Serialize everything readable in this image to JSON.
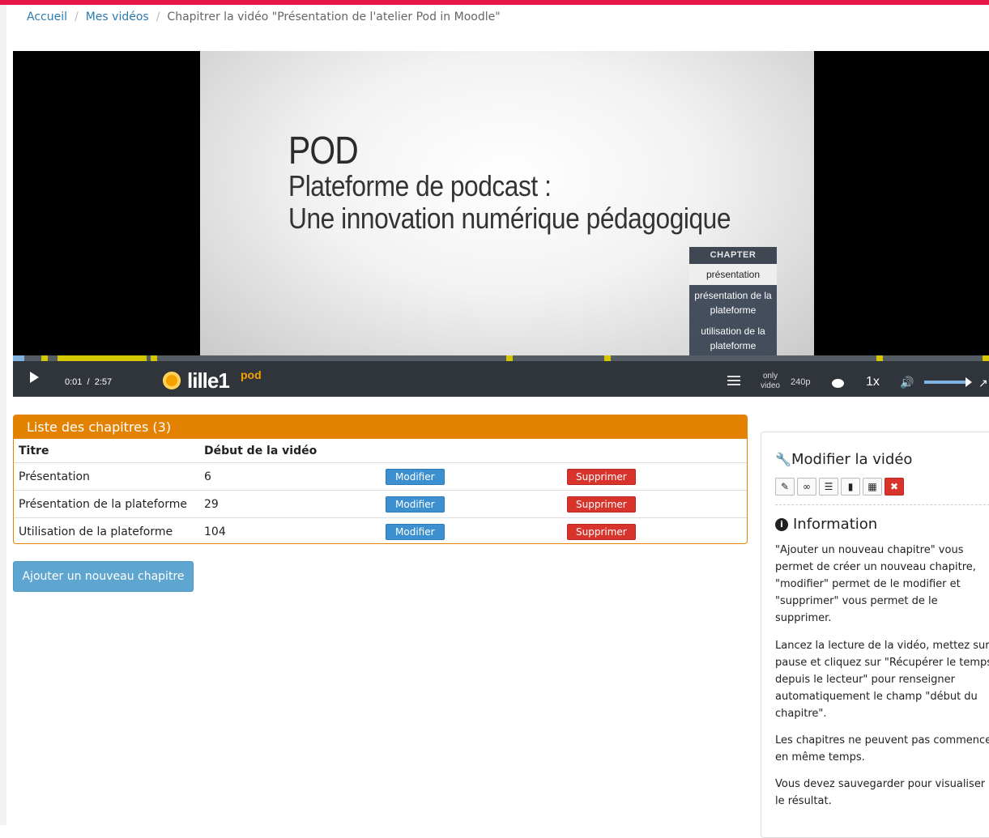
{
  "breadcrumb": {
    "home": "Accueil",
    "my_videos": "Mes vidéos",
    "current": "Chapitrer la vidéo \"Présentation de l'atelier Pod in Moodle\""
  },
  "video": {
    "slide_title": "POD",
    "slide_line1": "Plateforme de podcast :",
    "slide_line2": "Une innovation numérique pédagogique",
    "chapter_menu": {
      "heading": "CHAPTER",
      "items": [
        "présentation",
        "présentation de la plateforme",
        "utilisation de la plateforme"
      ],
      "active_index": 0
    },
    "current_time": "0:01",
    "time_separator": "/",
    "duration": "2:57",
    "logo_text": "lille1",
    "logo_suffix": "pod",
    "only_video_label": "only video",
    "quality": "240p",
    "speed": "1x",
    "played_fraction": 0.012,
    "chapter_marker_times": [
      6,
      29,
      104
    ]
  },
  "chapters_panel": {
    "title": "Liste des chapitres (3)",
    "columns": [
      "Titre",
      "Début de la vidéo"
    ],
    "rows": [
      {
        "title": "Présentation",
        "start": "6",
        "edit": "Modifier",
        "delete": "Supprimer"
      },
      {
        "title": "Présentation de la plateforme",
        "start": "29",
        "edit": "Modifier",
        "delete": "Supprimer"
      },
      {
        "title": "Utilisation de la plateforme",
        "start": "104",
        "edit": "Modifier",
        "delete": "Supprimer"
      }
    ]
  },
  "add_button": "Ajouter un nouveau chapitre",
  "sidebar": {
    "edit_title": "Modifier la vidéo",
    "tools": [
      "pencil-icon",
      "paperclip-icon",
      "list-icon",
      "file-icon",
      "film-icon",
      "delete-icon"
    ],
    "info_title": "Information",
    "p1": "\"Ajouter un nouveau chapitre\" vous permet de créer un nouveau chapitre, \"modifier\" permet de le modifier et \"supprimer\" vous permet de le supprimer.",
    "p2": "Lancez la lecture de la vidéo, mettez sur pause et cliquez sur \"Récupérer le temps depuis le lecteur\" pour renseigner automatiquement le champ \"début du chapitre\".",
    "p3": "Les chapitres ne peuvent pas commencer en même temps.",
    "p4": "Vous devez sauvegarder pour visualiser le résultat."
  },
  "colors": {
    "top_bar": "#e8174a",
    "panel_orange": "#e38200",
    "edit_blue": "#3d90cf",
    "delete_red": "#d9342c",
    "add_blue": "#5ea5d0",
    "marker_yellow": "#d5c800"
  }
}
